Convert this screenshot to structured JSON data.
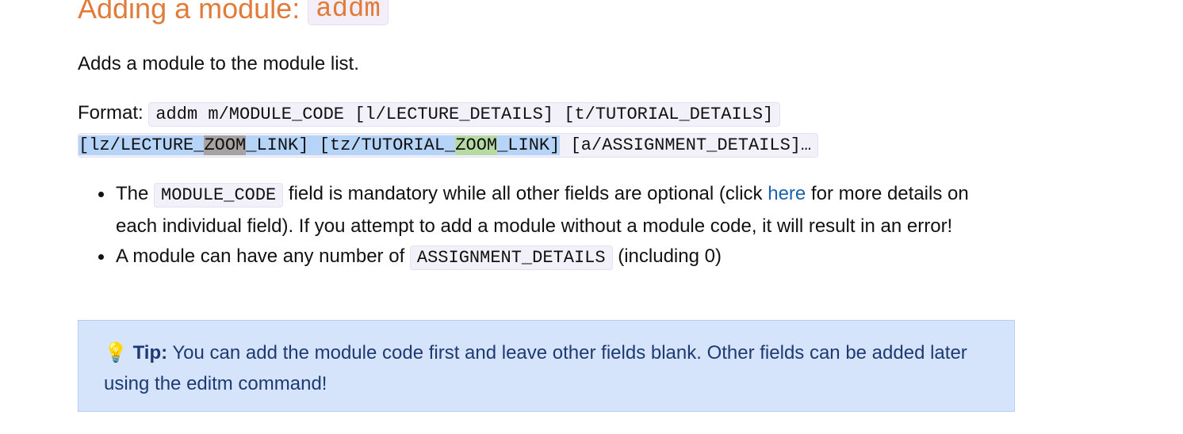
{
  "heading": {
    "prefix": "Adding a module:",
    "command": "addm"
  },
  "intro": "Adds a module to the module list.",
  "format": {
    "label": "Format:",
    "line1_code": "addm m/MODULE_CODE [l/LECTURE_DETAILS] [t/TUTORIAL_DETAILS]",
    "line2_seg1": "[lz/LECTURE_",
    "line2_zoom1": "ZOOM",
    "line2_seg2": "_LINK] [tz/TUTORIAL_",
    "line2_zoom2": "ZOOM",
    "line2_seg3": "_LINK]",
    "line2_seg4": " [a/ASSIGNMENT_DETAILS]…"
  },
  "bullets": {
    "item1": {
      "t1": "The ",
      "code": "MODULE_CODE",
      "t2": " field is mandatory while all other fields are optional (click ",
      "link": "here",
      "t3": " for more details on each individual field). If you attempt to add a module without a module code, it will result in an error!"
    },
    "item2": {
      "t1": "A module can have any number of ",
      "code": "ASSIGNMENT_DETAILS",
      "t2": " (including 0)"
    }
  },
  "tip": {
    "icon": "lightbulb-icon",
    "icon_glyph": "💡",
    "label": "Tip:",
    "text": " You can add the module code first and leave other fields blank. Other fields can be added later using the editm command!"
  },
  "colors": {
    "heading": "#e07b39",
    "link": "#1f5fb0",
    "tip_background": "#d6e4fb",
    "tip_text": "#1e3a73",
    "selection": "#b6d4f7"
  }
}
